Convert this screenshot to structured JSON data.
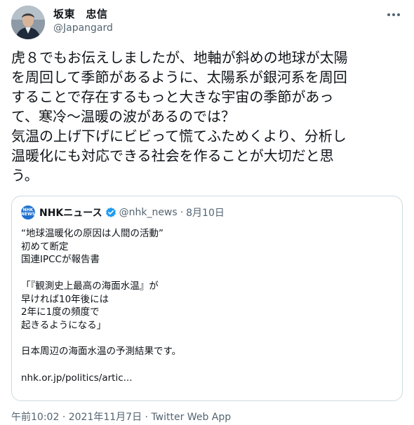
{
  "author": {
    "name": "坂東　忠信",
    "handle": "@Japangard"
  },
  "tweet": {
    "text": "虎８でもお伝えしましたが、地軸が斜めの地球が太陽\nを周回して季節があるように、太陽系が銀河系を周回\nすることで存在するもっと大きな宇宙の季節があっ\nて、寒冷〜温暖の波があるのでは？\n気温の上げ下げにビビって慌てふためくより、分析し\n温暖化にも対応できる社会を作ることが大切だと思\nう。"
  },
  "quoted": {
    "logo_text_top": "NHK",
    "logo_text_bottom": "NEWS",
    "name": "NHKニュース",
    "handle": "@nhk_news",
    "separator": "·",
    "date": "8月10日",
    "text": "“地球温暖化の原因は人間の活動”\n初めて断定\n国連IPCCが報告書\n\n「『観測史上最高の海面水温』が\n早ければ10年後には\n2年に1度の頻度で\n起きるようになる」\n\n日本周辺の海面水温の予測結果です。\n\nnhk.or.jp/politics/artic..."
  },
  "meta": {
    "time": "午前10:02",
    "separator1": "·",
    "date": "2021年11月7日",
    "separator2": "·",
    "source": "Twitter Web App"
  },
  "icons": {
    "more": "more-horizontal-icon",
    "verified": "verified-badge-icon"
  },
  "colors": {
    "text": "#0f1419",
    "secondary": "#536471",
    "verified": "#1d9bf0",
    "border": "#cfd9de",
    "nhk_blue": "#1d6fcf"
  }
}
